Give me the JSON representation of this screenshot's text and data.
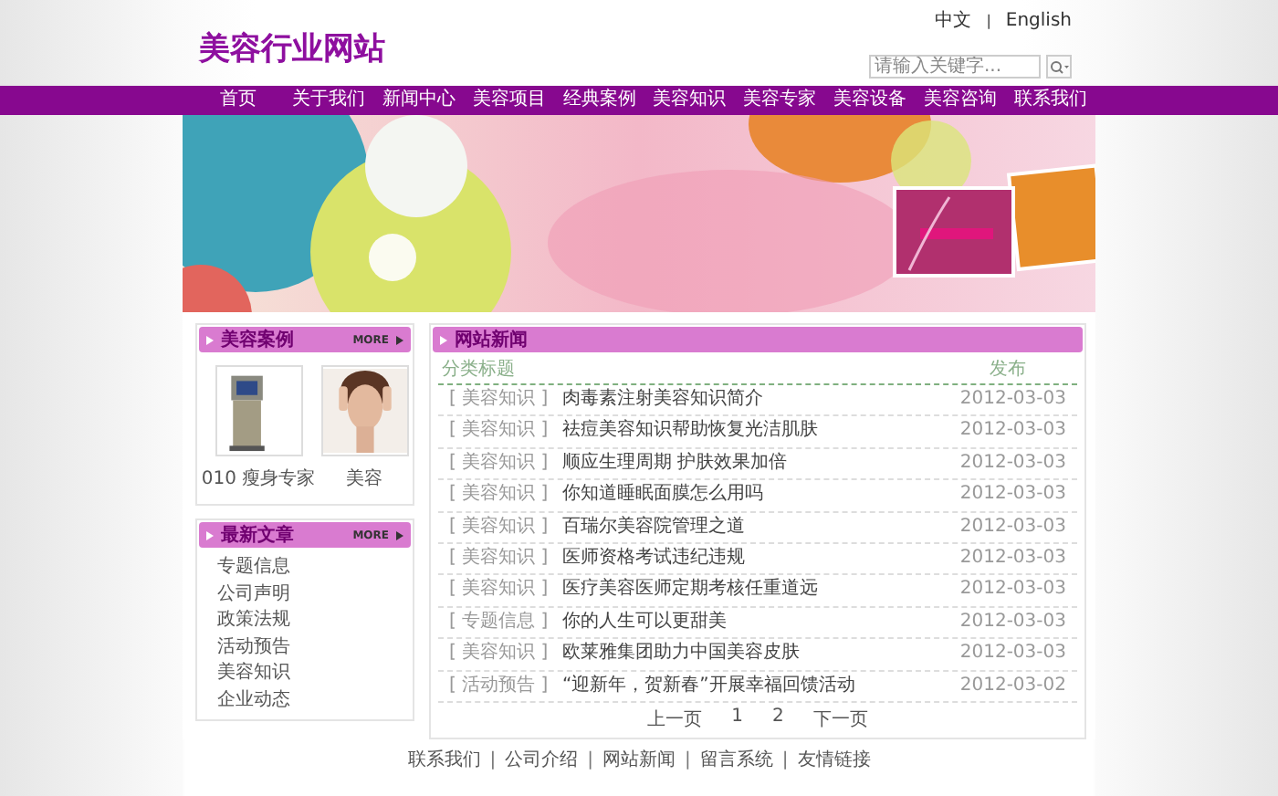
{
  "header": {
    "site_title": "美容行业网站",
    "languages": [
      "中文",
      "English"
    ],
    "language_separator": "|",
    "search": {
      "placeholder": "请输入关键字..."
    }
  },
  "nav": [
    "首页",
    "关于我们",
    "新闻中心",
    "美容项目",
    "经典案例",
    "美容知识",
    "美容专家",
    "美容设备",
    "美容咨询",
    "联系我们"
  ],
  "cases": {
    "title": "美容案例",
    "more": "MORE",
    "items": [
      {
        "caption": "010 瘦身专家",
        "kind": "machine"
      },
      {
        "caption": "美容",
        "kind": "portrait"
      }
    ]
  },
  "articles": {
    "title": "最新文章",
    "more": "MORE",
    "items": [
      "专题信息",
      "公司声明",
      "政策法规",
      "活动预告",
      "美容知识",
      "企业动态"
    ]
  },
  "news": {
    "title": "网站新闻",
    "columns": [
      "分类标题",
      "发布"
    ],
    "rows": [
      {
        "category": "[ 美容知识 ]",
        "title": "肉毒素注射美容知识简介",
        "date": "2012-03-03"
      },
      {
        "category": "[ 美容知识 ]",
        "title": "祛痘美容知识帮助恢复光洁肌肤",
        "date": "2012-03-03"
      },
      {
        "category": "[ 美容知识 ]",
        "title": "顺应生理周期 护肤效果加倍",
        "date": "2012-03-03"
      },
      {
        "category": "[ 美容知识 ]",
        "title": "你知道睡眠面膜怎么用吗",
        "date": "2012-03-03"
      },
      {
        "category": "[ 美容知识 ]",
        "title": "百瑞尔美容院管理之道",
        "date": "2012-03-03"
      },
      {
        "category": "[ 美容知识 ]",
        "title": "医师资格考试违纪违规",
        "date": "2012-03-03"
      },
      {
        "category": "[ 美容知识 ]",
        "title": "医疗美容医师定期考核任重道远",
        "date": "2012-03-03"
      },
      {
        "category": "[ 专题信息 ]",
        "title": "你的人生可以更甜美",
        "date": "2012-03-03"
      },
      {
        "category": "[ 美容知识 ]",
        "title": "欧莱雅集团助力中国美容皮肤",
        "date": "2012-03-03"
      },
      {
        "category": "[ 活动预告 ]",
        "title": "“迎新年，贺新春”开展幸福回馈活动",
        "date": "2012-03-02"
      }
    ],
    "pagination": {
      "prev": "上一页",
      "pages": [
        "1",
        "2"
      ],
      "next": "下一页"
    }
  },
  "footer": {
    "links": [
      "联系我们",
      "公司介绍",
      "网站新闻",
      "留言系统",
      "友情链接"
    ],
    "separator": "|"
  }
}
